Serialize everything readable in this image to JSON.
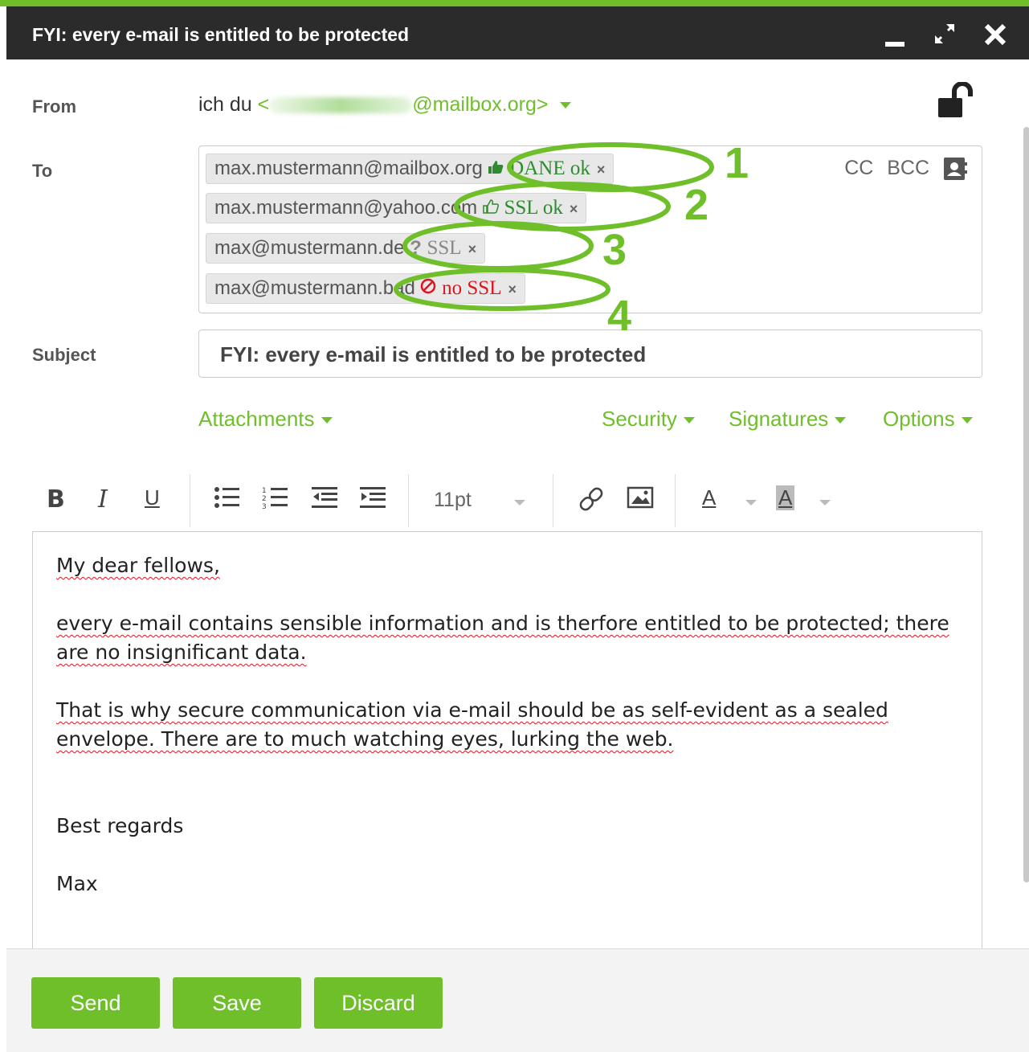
{
  "window": {
    "title": "FYI: every e-mail is entitled to be protected",
    "minimize_icon": "minimize-icon",
    "maximize_icon": "expand-icon",
    "close_icon": "close-icon"
  },
  "from": {
    "label": "From",
    "name": "ich du",
    "open_bracket": "<",
    "domain_suffix": "@mailbox.org>",
    "lock_icon": "unlocked-padlock-icon"
  },
  "to": {
    "label": "To",
    "recipients": [
      {
        "email": "max.mustermann@mailbox.org",
        "status_icon": "thumbs-up-filled-icon",
        "status": "DANE ok",
        "remove": "×"
      },
      {
        "email": "max.mustermann@yahoo.com",
        "status_icon": "thumbs-up-outline-icon",
        "status": "SSL ok",
        "remove": "×"
      },
      {
        "email": "max@mustermann.de",
        "status_icon": "question-icon",
        "status_prefix": "?",
        "status": "SSL",
        "remove": "×"
      },
      {
        "email": "max@mustermann.bad",
        "status_icon": "forbidden-icon",
        "status": "no SSL",
        "remove": "×"
      }
    ],
    "cc_label": "CC",
    "bcc_label": "BCC",
    "contacts_icon": "address-book-icon"
  },
  "annotations": [
    "1",
    "2",
    "3",
    "4"
  ],
  "subject": {
    "label": "Subject",
    "value": "FYI: every e-mail is entitled to be protected"
  },
  "options_row": {
    "attachments": "Attachments",
    "security": "Security",
    "signatures": "Signatures",
    "options": "Options"
  },
  "toolbar": {
    "bold": "B",
    "italic": "I",
    "underline": "U",
    "font_size": "11pt",
    "font_color_letter": "A",
    "background_color_letter": "A"
  },
  "body": {
    "greeting": "My dear fellows,",
    "paragraph1": "every e-mail contains sensible information and is therfore entitled to be protected; there are no insignificant data.",
    "paragraph2": "That is why secure communication via e-mail should be as self-evident as a sealed envelope. There are to much watching eyes, lurking the web.",
    "closing": "Best regards",
    "signature": "Max"
  },
  "footer": {
    "send": "Send",
    "save": "Save",
    "discard": "Discard"
  },
  "colors": {
    "accent": "#6fbf2a",
    "titlebar": "#2b2b2b",
    "ok_green": "#2e8b2e",
    "error_red": "#e0141e"
  }
}
